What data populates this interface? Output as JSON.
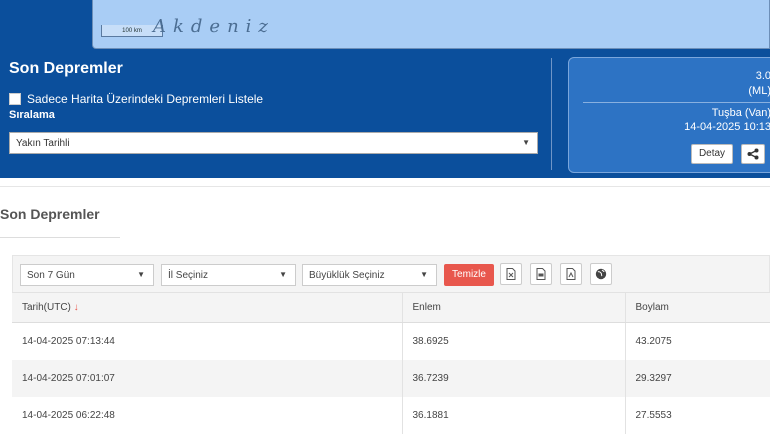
{
  "map": {
    "scale_label": "100 km",
    "sea_label": "Akdeniz"
  },
  "panel": {
    "title": "Son Depremler",
    "checkbox_label": "Sadece Harita Üzerindeki Depremleri Listele",
    "sort_label": "Sıralama",
    "sort_value": "Yakın Tarihli"
  },
  "quake_card": {
    "magnitude": "3.0",
    "magnitude_type": "(ML)",
    "location": "Tuşba (Van)",
    "datetime": "14-04-2025 10:13",
    "detail_button": "Detay",
    "share_icon": "share-icon"
  },
  "section": {
    "title": "Son Depremler"
  },
  "filters": {
    "days": "Son 7 Gün",
    "province": "İl Seçiniz",
    "magnitude": "Büyüklük Seçiniz",
    "clear_button": "Temizle",
    "export_icons": [
      "excel-icon",
      "csv-icon",
      "pdf-icon",
      "kml-globe-icon"
    ]
  },
  "table": {
    "columns": [
      "Tarih(UTC)",
      "Enlem",
      "Boylam"
    ],
    "sort_indicator": "↓",
    "rows": [
      [
        "14-04-2025 07:13:44",
        "38.6925",
        "43.2075"
      ],
      [
        "14-04-2025 07:01:07",
        "36.7239",
        "29.3297"
      ],
      [
        "14-04-2025 06:22:48",
        "36.1881",
        "27.5553"
      ]
    ]
  }
}
